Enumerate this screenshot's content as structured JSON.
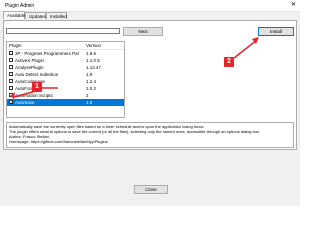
{
  "window": {
    "title": "Plugin Admin",
    "close_glyph": "✕"
  },
  "tabs": [
    {
      "label": "Available"
    },
    {
      "label": "Updates"
    },
    {
      "label": "Installed"
    }
  ],
  "search": {
    "value": ""
  },
  "buttons": {
    "next": "Next",
    "install": "Install",
    "close": "Close"
  },
  "list": {
    "headers": {
      "plugin": "Plugin",
      "version": "Version"
    },
    "rows": [
      {
        "name": "3P - Progress Programmers Pal",
        "version": "1.8.6",
        "checked": false,
        "selected": false
      },
      {
        "name": "ActiveX Plugin",
        "version": "1.1.0.5",
        "checked": false,
        "selected": false
      },
      {
        "name": "AnalysePlugin",
        "version": "1.12.47",
        "checked": false,
        "selected": false
      },
      {
        "name": "Auto Detect Indention",
        "version": "1.9",
        "checked": false,
        "selected": false
      },
      {
        "name": "AutoCodepage",
        "version": "1.2.4",
        "checked": false,
        "selected": false
      },
      {
        "name": "AutoFormat",
        "version": "1.0.2",
        "checked": false,
        "selected": false
      },
      {
        "name": "Automation Scripts",
        "version": "2",
        "checked": false,
        "selected": false
      },
      {
        "name": "AutoSave",
        "version": "1.6",
        "checked": true,
        "selected": true
      }
    ]
  },
  "description": {
    "line1": "Automatically save the currently open files based on a timer schedule and/or upon the application losing focus.",
    "line2": "The plugin offers several options to save the current (or all the files), selecting only the named ones, accessible through an options dialog box.",
    "line3": "Author: Franco Stellari",
    "line4": "Homepage: https://github.com/francostellari/NppPlugins"
  },
  "annotations": {
    "badge1": "1",
    "badge2": "2",
    "color": "#e3242b"
  }
}
